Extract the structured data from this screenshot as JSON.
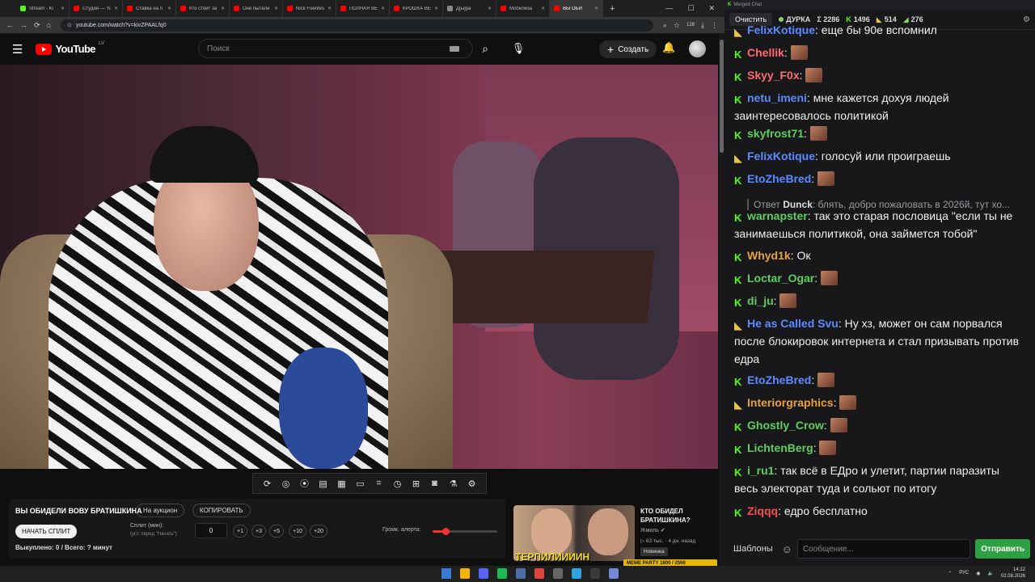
{
  "browser": {
    "tabs": [
      {
        "label": "Stream - Ki",
        "color": "#53fc18"
      },
      {
        "label": "Студия — Yo",
        "color": "#ff0000"
      },
      {
        "label": "Ставка на п",
        "color": "#ff0000"
      },
      {
        "label": "Кто стоит за",
        "color": "#ff0000"
      },
      {
        "label": "Они пытали",
        "color": "#ff0000"
      },
      {
        "label": "Nick Fuentes",
        "color": "#ff0000"
      },
      {
        "label": "ПОЛНАЯ ВЕ",
        "color": "#ff0000"
      },
      {
        "label": "КРОШКА ВЕ",
        "color": "#ff0000"
      },
      {
        "label": "Д[ы]ра",
        "color": "#888888"
      },
      {
        "label": "Мобилиза",
        "color": "#ff0000"
      },
      {
        "label": "ВЫ ОБИ",
        "color": "#ff0000",
        "active": true
      }
    ],
    "new_tab": "+",
    "url": "youtube.com/watch?v=kivZPAALfq0",
    "extension_badge": "128"
  },
  "youtube": {
    "logo_text": "YouTube",
    "logo_region": "LV",
    "search_placeholder": "Поиск",
    "create_label": "Создать"
  },
  "toolbar_icons": [
    "repeat-icon",
    "broadcast-icon",
    "record-icon",
    "clip-icon",
    "slate-icon",
    "frame-icon",
    "crop-icon",
    "speed-icon",
    "add-icon",
    "screenshot-icon",
    "lab-icon",
    "gear-icon"
  ],
  "auction": {
    "title": "ВЫ ОБИДЕЛИ ВОВУ БРАТИШКИНА",
    "auction_button": "На аукцион",
    "copy_button": "КОПИРОВАТЬ",
    "start_button": "НАЧАТЬ СПЛИТ",
    "split_label": "Сплит (мин):",
    "split_hint": "(уст. перед \"Начать\")",
    "split_value": "0",
    "increments": [
      "+1",
      "+3",
      "+5",
      "+10",
      "+20"
    ],
    "volume_label": "Громк. алерта:",
    "volume_level": 0.2,
    "bought": "Выкуплено: 0 / Всего: ? минут"
  },
  "recommendation": {
    "thumb_text": "ТЕРПИЛИИИИН",
    "title": "КТО ОБИДЕЛ БРАТИШКИНА?",
    "channel": "Жмиль",
    "stats": "▷ 63 тыс. · 4 дн. назад",
    "badge": "Новинка",
    "bar_text": "MEME PARTY 1800 / 2500"
  },
  "chat": {
    "window_title": "Merged Chat",
    "clear_button": "Очистить",
    "channel": "ДУРКА",
    "sum": "Σ 2286",
    "kick_count": "1496",
    "twitch_count": "514",
    "other_count": "276",
    "templates_button": "Шаблоны",
    "input_placeholder": "Сообщение...",
    "send_button": "Отправить",
    "messages": [
      {
        "src": "s",
        "nick": "FelixKotique",
        "color": "#5a8cff",
        "text": "еще бы 90е вспомнил"
      },
      {
        "src": "k",
        "nick": "Chellik",
        "color": "#ff6b6b",
        "emote": true
      },
      {
        "src": "k",
        "nick": "Skyy_F0x",
        "color": "#ff6b6b",
        "emote": true
      },
      {
        "src": "k",
        "nick": "netu_imeni",
        "color": "#5a8cff",
        "text": "мне кажется дохуя людей заинтересовалось политикой"
      },
      {
        "src": "k",
        "nick": "skyfrost71",
        "color": "#5ecf5e",
        "emote": true
      },
      {
        "src": "s",
        "nick": "FelixKotique",
        "color": "#5a8cff",
        "text": "голосуй или проиграешь"
      },
      {
        "src": "k",
        "nick": "EtoZheBred",
        "color": "#5a8cff",
        "emote": true
      },
      {
        "reply_to": "Dunck",
        "reply_text": "блять, добро пожаловать в 2026й, тут хо..."
      },
      {
        "src": "k",
        "nick": "warnapster",
        "color": "#5ecf5e",
        "text": "так это старая пословица \"если ты не занимаешься политикой, она займется тобой\""
      },
      {
        "src": "k",
        "nick": "Whyd1k",
        "color": "#e8a13c",
        "text": "Ок"
      },
      {
        "src": "k",
        "nick": "Loctar_Ogar",
        "color": "#5ecf5e",
        "emote": true
      },
      {
        "src": "k",
        "nick": "di_ju",
        "color": "#5ecf5e",
        "emote": true
      },
      {
        "src": "s",
        "nick": "He as Called Svu",
        "color": "#5a8cff",
        "text": "Ну хз, может он сам порвался после блокировок интернета и стал призывать против едра"
      },
      {
        "src": "k",
        "nick": "EtoZheBred",
        "color": "#5a8cff",
        "emote": true
      },
      {
        "src": "s",
        "nick": "Interiorgraphics",
        "color": "#e8a13c",
        "emote": true
      },
      {
        "src": "k",
        "nick": "Ghostly_Crow",
        "color": "#5ecf5e",
        "emote": true
      },
      {
        "src": "k",
        "nick": "LichtenBerg",
        "color": "#5ecf5e",
        "emote": true
      },
      {
        "src": "k",
        "nick": "i_ru1",
        "color": "#5ecf5e",
        "text": "так всё в ЕДро и улетит, партии паразиты весь электорат туда и сольют по итогу"
      },
      {
        "src": "k",
        "nick": "Ziqqq",
        "color": "#ff4d4d",
        "text": "едро бесплатно"
      }
    ]
  },
  "taskbar": {
    "lang": "РУС",
    "time": "14:12",
    "date": "02.08.2026"
  }
}
